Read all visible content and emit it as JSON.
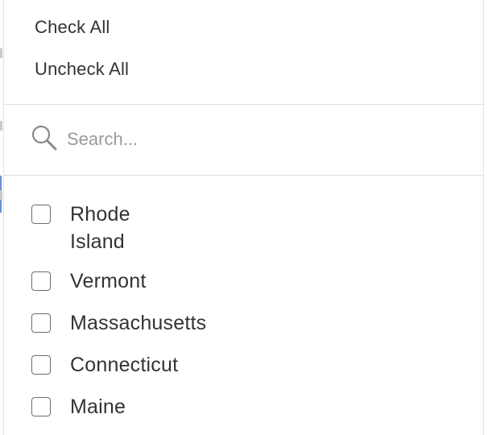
{
  "dropdown": {
    "actions": {
      "check_all": "Check All",
      "uncheck_all": "Uncheck All"
    },
    "search": {
      "placeholder": "Search...",
      "value": "",
      "icon": "search-icon"
    },
    "options": [
      {
        "label": "Rhode Island",
        "checked": false
      },
      {
        "label": "Vermont",
        "checked": false
      },
      {
        "label": "Massachusetts",
        "checked": false
      },
      {
        "label": "Connecticut",
        "checked": false
      },
      {
        "label": "Maine",
        "checked": false
      }
    ]
  },
  "colors": {
    "text": "#333333",
    "placeholder": "#9a9a9a",
    "divider": "#dcdcdc",
    "checkbox_border": "#6b6b6b"
  }
}
